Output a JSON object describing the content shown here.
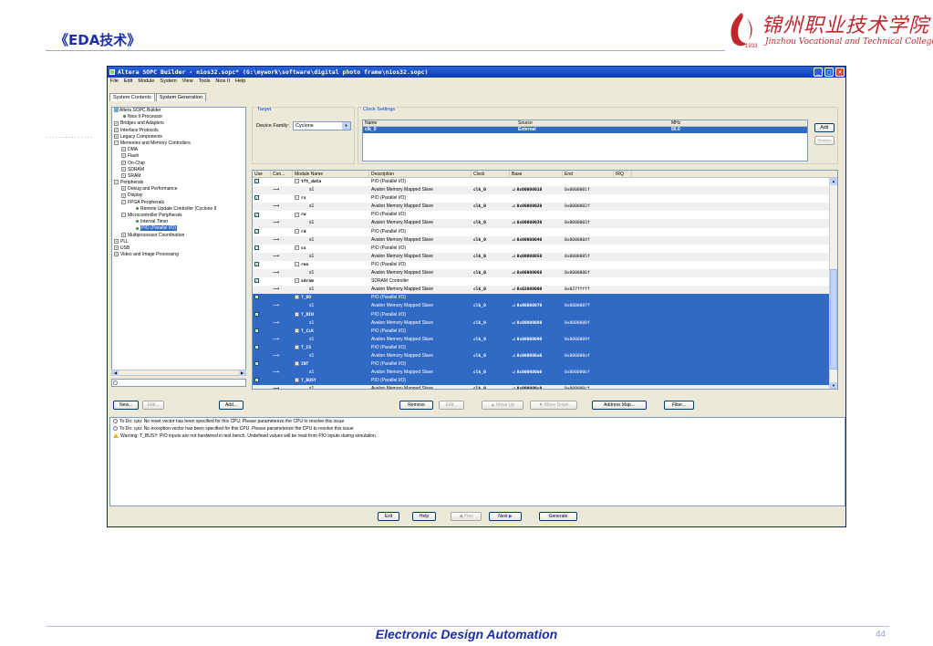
{
  "slide": {
    "title": "《EDA技术》",
    "logo_cn": "锦州职业技术学院",
    "logo_en": "Jinzhou Vocational and Technical College",
    "logo_year": "1933",
    "dots": "...............",
    "footer": "Electronic Design Automation",
    "page_number": "44"
  },
  "window": {
    "title": "Altera SOPC Builder - nios32.sopc* (G:\\mywork\\software\\digital photo frame\\nios32.sopc)",
    "menu": [
      "File",
      "Edit",
      "Module",
      "System",
      "View",
      "Tools",
      "Nios II",
      "Help"
    ],
    "tabs": [
      "System Contents",
      "System Generation"
    ]
  },
  "tree": {
    "items": [
      {
        "label": "Altera SOPC Builder",
        "kind": "root"
      },
      {
        "label": "Nios II Processor",
        "kind": "leaf"
      },
      {
        "label": "Bridges and Adapters",
        "kind": "plus"
      },
      {
        "label": "Interface Protocols",
        "kind": "plus"
      },
      {
        "label": "Legacy Components",
        "kind": "plus"
      },
      {
        "label": "Memories and Memory Controllers",
        "kind": "minus"
      },
      {
        "label": "DMA",
        "kind": "plus2"
      },
      {
        "label": "Flash",
        "kind": "plus2"
      },
      {
        "label": "On-Chip",
        "kind": "plus2"
      },
      {
        "label": "SDRAM",
        "kind": "plus2"
      },
      {
        "label": "SRAM",
        "kind": "plus2"
      },
      {
        "label": "Peripherals",
        "kind": "minus"
      },
      {
        "label": "Debug and Performance",
        "kind": "plus2"
      },
      {
        "label": "Display",
        "kind": "plus2"
      },
      {
        "label": "FPGA Peripherals",
        "kind": "minus2"
      },
      {
        "label": "Remote Update Controller (Cyclone II",
        "kind": "leaf3"
      },
      {
        "label": "Microcontroller Peripherals",
        "kind": "minus2"
      },
      {
        "label": "Interval Timer",
        "kind": "leaf3"
      },
      {
        "label": "PIO (Parallel I/O)",
        "kind": "leaf3sel"
      },
      {
        "label": "Multiprocessor Coordination",
        "kind": "plus2"
      },
      {
        "label": "PLL",
        "kind": "plus"
      },
      {
        "label": "USB",
        "kind": "plus"
      },
      {
        "label": "Video and Image Processing",
        "kind": "plus"
      }
    ],
    "buttons": {
      "new": "New...",
      "edit": "Edit...",
      "add": "Add..."
    }
  },
  "target": {
    "group_title": "Target",
    "device_label": "Device Family:",
    "device_value": "Cyclone"
  },
  "clock": {
    "group_title": "Clock Settings",
    "headers": [
      "Name",
      "Source",
      "MHz"
    ],
    "row": [
      "clk_0",
      "External",
      "50.0"
    ],
    "add_button": "Add",
    "remove_button": "Remove"
  },
  "modules": {
    "headers": [
      "Use",
      "Con...",
      "Module Name",
      "Description",
      "Clock",
      "Base",
      "End",
      "IRQ"
    ],
    "rows": [
      {
        "use": true,
        "name": "tft_data",
        "desc": "PIO (Parallel I/O)",
        "clock": "",
        "base": "",
        "end": "",
        "type": "module"
      },
      {
        "use": false,
        "name": "s1",
        "desc": "Avalon Memory Mapped Slave",
        "clock": "clk_0",
        "base": "0x00000010",
        "end": "0x0000001f",
        "type": "slave"
      },
      {
        "use": true,
        "name": "rs",
        "desc": "PIO (Parallel I/O)",
        "clock": "",
        "base": "",
        "end": "",
        "type": "module"
      },
      {
        "use": false,
        "name": "s1",
        "desc": "Avalon Memory Mapped Slave",
        "clock": "clk_0",
        "base": "0x00000020",
        "end": "0x0000002f",
        "type": "slave"
      },
      {
        "use": true,
        "name": "rw",
        "desc": "PIO (Parallel I/O)",
        "clock": "",
        "base": "",
        "end": "",
        "type": "module"
      },
      {
        "use": false,
        "name": "s1",
        "desc": "Avalon Memory Mapped Slave",
        "clock": "clk_0",
        "base": "0x00000030",
        "end": "0x0000003f",
        "type": "slave"
      },
      {
        "use": true,
        "name": "rd",
        "desc": "PIO (Parallel I/O)",
        "clock": "",
        "base": "",
        "end": "",
        "type": "module"
      },
      {
        "use": false,
        "name": "s1",
        "desc": "Avalon Memory Mapped Slave",
        "clock": "clk_0",
        "base": "0x00000040",
        "end": "0x0000004f",
        "type": "slave"
      },
      {
        "use": true,
        "name": "cs",
        "desc": "PIO (Parallel I/O)",
        "clock": "",
        "base": "",
        "end": "",
        "type": "module"
      },
      {
        "use": false,
        "name": "s1",
        "desc": "Avalon Memory Mapped Slave",
        "clock": "clk_0",
        "base": "0x00000050",
        "end": "0x0000005f",
        "type": "slave"
      },
      {
        "use": true,
        "name": "res",
        "desc": "PIO (Parallel I/O)",
        "clock": "",
        "base": "",
        "end": "",
        "type": "module"
      },
      {
        "use": false,
        "name": "s1",
        "desc": "Avalon Memory Mapped Slave",
        "clock": "clk_0",
        "base": "0x00000060",
        "end": "0x0000006f",
        "type": "slave"
      },
      {
        "use": true,
        "name": "sdram",
        "desc": "SDRAM Controller",
        "clock": "",
        "base": "",
        "end": "",
        "type": "module"
      },
      {
        "use": false,
        "name": "s1",
        "desc": "Avalon Memory Mapped Slave",
        "clock": "clk_0",
        "base": "0x02000000",
        "end": "0x027fffff",
        "type": "slave"
      },
      {
        "use": true,
        "name": "T_DO",
        "desc": "PIO (Parallel I/O)",
        "clock": "",
        "base": "",
        "end": "",
        "type": "module",
        "sel": true
      },
      {
        "use": false,
        "name": "s1",
        "desc": "Avalon Memory Mapped Slave",
        "clock": "clk_0",
        "base": "0x00000070",
        "end": "0x0000007f",
        "type": "slave",
        "sel": true
      },
      {
        "use": true,
        "name": "T_DIN",
        "desc": "PIO (Parallel I/O)",
        "clock": "",
        "base": "",
        "end": "",
        "type": "module",
        "sel": true
      },
      {
        "use": false,
        "name": "s1",
        "desc": "Avalon Memory Mapped Slave",
        "clock": "clk_0",
        "base": "0x00000080",
        "end": "0x0000008f",
        "type": "slave",
        "sel": true
      },
      {
        "use": true,
        "name": "T_CLK",
        "desc": "PIO (Parallel I/O)",
        "clock": "",
        "base": "",
        "end": "",
        "type": "module",
        "sel": true
      },
      {
        "use": false,
        "name": "s1",
        "desc": "Avalon Memory Mapped Slave",
        "clock": "clk_0",
        "base": "0x00000090",
        "end": "0x0000009f",
        "type": "slave",
        "sel": true
      },
      {
        "use": true,
        "name": "T_CS",
        "desc": "PIO (Parallel I/O)",
        "clock": "",
        "base": "",
        "end": "",
        "type": "module",
        "sel": true
      },
      {
        "use": false,
        "name": "s1",
        "desc": "Avalon Memory Mapped Slave",
        "clock": "clk_0",
        "base": "0x000000a0",
        "end": "0x000000af",
        "type": "slave",
        "sel": true
      },
      {
        "use": true,
        "name": "INT",
        "desc": "PIO (Parallel I/O)",
        "clock": "",
        "base": "",
        "end": "",
        "type": "module",
        "sel": true
      },
      {
        "use": false,
        "name": "s1",
        "desc": "Avalon Memory Mapped Slave",
        "clock": "clk_0",
        "base": "0x000000b0",
        "end": "0x000000bf",
        "type": "slave",
        "sel": true
      },
      {
        "use": true,
        "name": "T_BUSY",
        "desc": "PIO (Parallel I/O)",
        "clock": "",
        "base": "",
        "end": "",
        "type": "module",
        "sel": true
      },
      {
        "use": false,
        "name": "s1",
        "desc": "Avalon Memory Mapped Slave",
        "clock": "clk_0",
        "base": "0x000000c0",
        "end": "0x000000cf",
        "type": "slave"
      }
    ],
    "buttons": {
      "remove": "Remove",
      "edit": "Edit...",
      "move_up": "Move Up",
      "move_down": "Move Down",
      "address_map": "Address Map...",
      "filter": "Filter..."
    }
  },
  "messages": [
    {
      "kind": "todo",
      "text": "To Do: cpu: No reset vector has been specified for this CPU. Please parameterize the CPU to resolve this issue"
    },
    {
      "kind": "todo",
      "text": "To Do: cpu: No exception vector has been specified for this CPU. Please parameterize the CPU to resolve this issue"
    },
    {
      "kind": "warning",
      "text": "Warning: T_BUSY: PIO inputs are not hardwired in test bench. Undefined values will be read from PIO inputs during simulation."
    }
  ],
  "bottom_buttons": {
    "exit": "Exit",
    "help": "Help",
    "prev": "Prev",
    "next": "Next",
    "generate": "Generate"
  },
  "colors": {
    "selection": "#316ac5",
    "title_blue": "#1b2fa8",
    "logo_red": "#c0272d"
  }
}
